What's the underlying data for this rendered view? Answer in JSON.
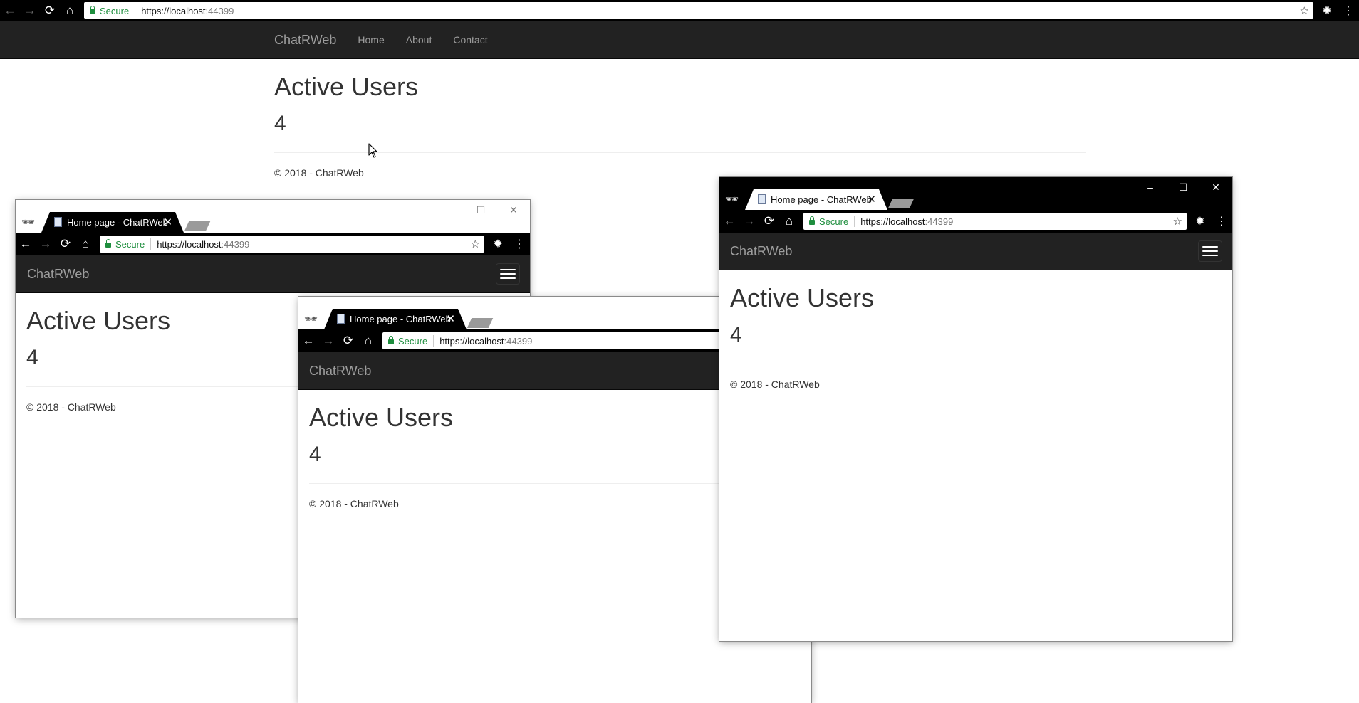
{
  "tab_title": "Home page - ChatRWeb",
  "omnibox": {
    "secure_label": "Secure",
    "url_host": "https://localhost",
    "url_port": ":44399"
  },
  "site": {
    "brand": "ChatRWeb",
    "nav": [
      "Home",
      "About",
      "Contact"
    ],
    "heading": "Active Users",
    "active_count": "4",
    "footer": "© 2018 - ChatRWeb"
  },
  "icons": {
    "back": "←",
    "forward": "→",
    "reload": "⟳",
    "home": "⌂",
    "star": "☆",
    "extension": "✹",
    "menu": "⋮",
    "minimize": "–",
    "maximize": "☐",
    "close": "✕",
    "incognito": "🕶"
  },
  "colors": {
    "navbar": "#222222",
    "brand_text": "#9d9d9d",
    "secure_green": "#1e8e3e",
    "chrome_dark": "#000000"
  }
}
